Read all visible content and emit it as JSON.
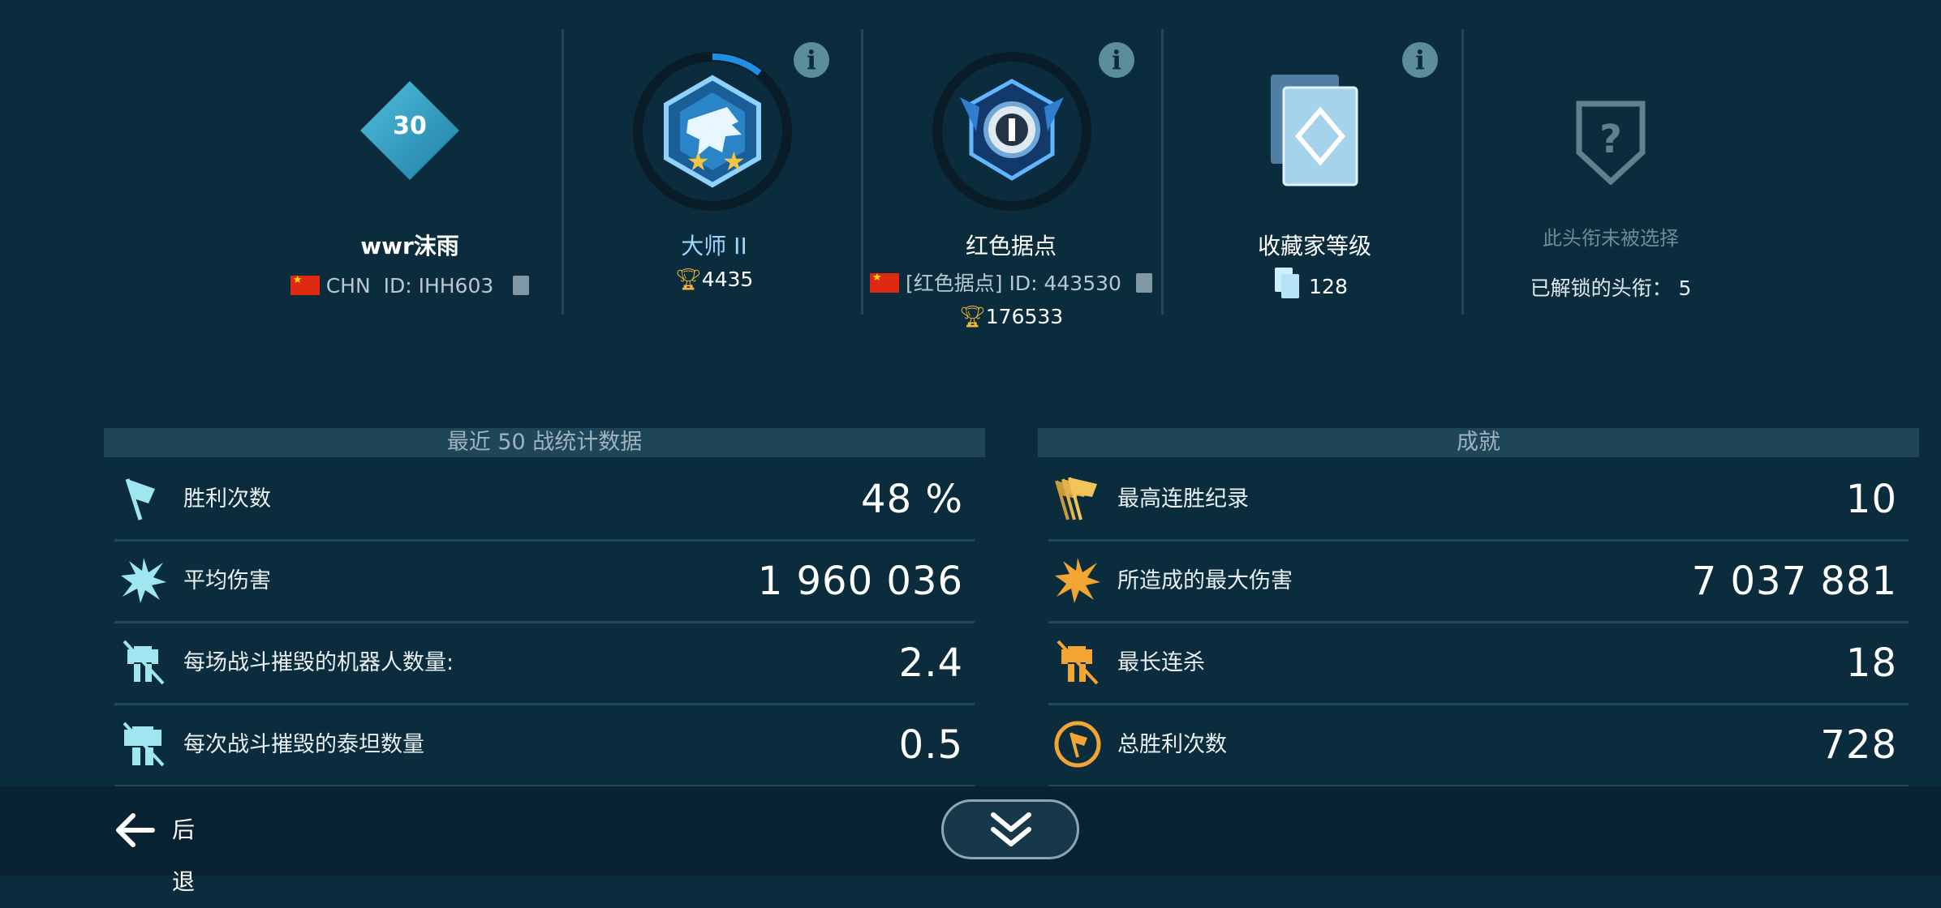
{
  "player": {
    "level": "30",
    "name": "wwr沫雨",
    "country": "CHN",
    "id": "ID: IHH603"
  },
  "league": {
    "rank": "大师 II",
    "trophies": "4435"
  },
  "clan": {
    "name": "红色据点",
    "tag_id": "[红色据点] ID: 443530",
    "trophies": "176533"
  },
  "collector": {
    "title": "收藏家等级",
    "count": "128"
  },
  "title_badge": {
    "status": "此头衔未被选择",
    "unlocked": "已解锁的头衔：  5"
  },
  "stats_panel": {
    "header": "最近 50 战统计数据",
    "rows": [
      {
        "label": "胜利次数",
        "value": "48 %",
        "icon": "flag-icon"
      },
      {
        "label": "平均伤害",
        "value": "1 960 036",
        "icon": "explosion-icon"
      },
      {
        "label": "每场战斗摧毁的机器人数量:",
        "value": "2.4",
        "icon": "destroyed-robot-icon"
      },
      {
        "label": "每次战斗摧毁的泰坦数量",
        "value": "0.5",
        "icon": "destroyed-titan-icon"
      }
    ]
  },
  "achievements_panel": {
    "header": "成就",
    "rows": [
      {
        "label": "最高连胜纪录",
        "value": "10",
        "icon": "flags-streak-icon"
      },
      {
        "label": "所造成的最大伤害",
        "value": "7 037 881",
        "icon": "explosion-icon"
      },
      {
        "label": "最长连杀",
        "value": "18",
        "icon": "destroyed-robot-icon"
      },
      {
        "label": "总胜利次数",
        "value": "728",
        "icon": "flag-circle-icon"
      }
    ]
  },
  "footer": {
    "back_label": "后退"
  },
  "colors": {
    "background": "#0b2c3d",
    "panel_header": "#1f4658",
    "stat_icon": "#9fe6f0",
    "achievement_icon": "#f3a533",
    "league_rank": "#9fd6ff"
  }
}
